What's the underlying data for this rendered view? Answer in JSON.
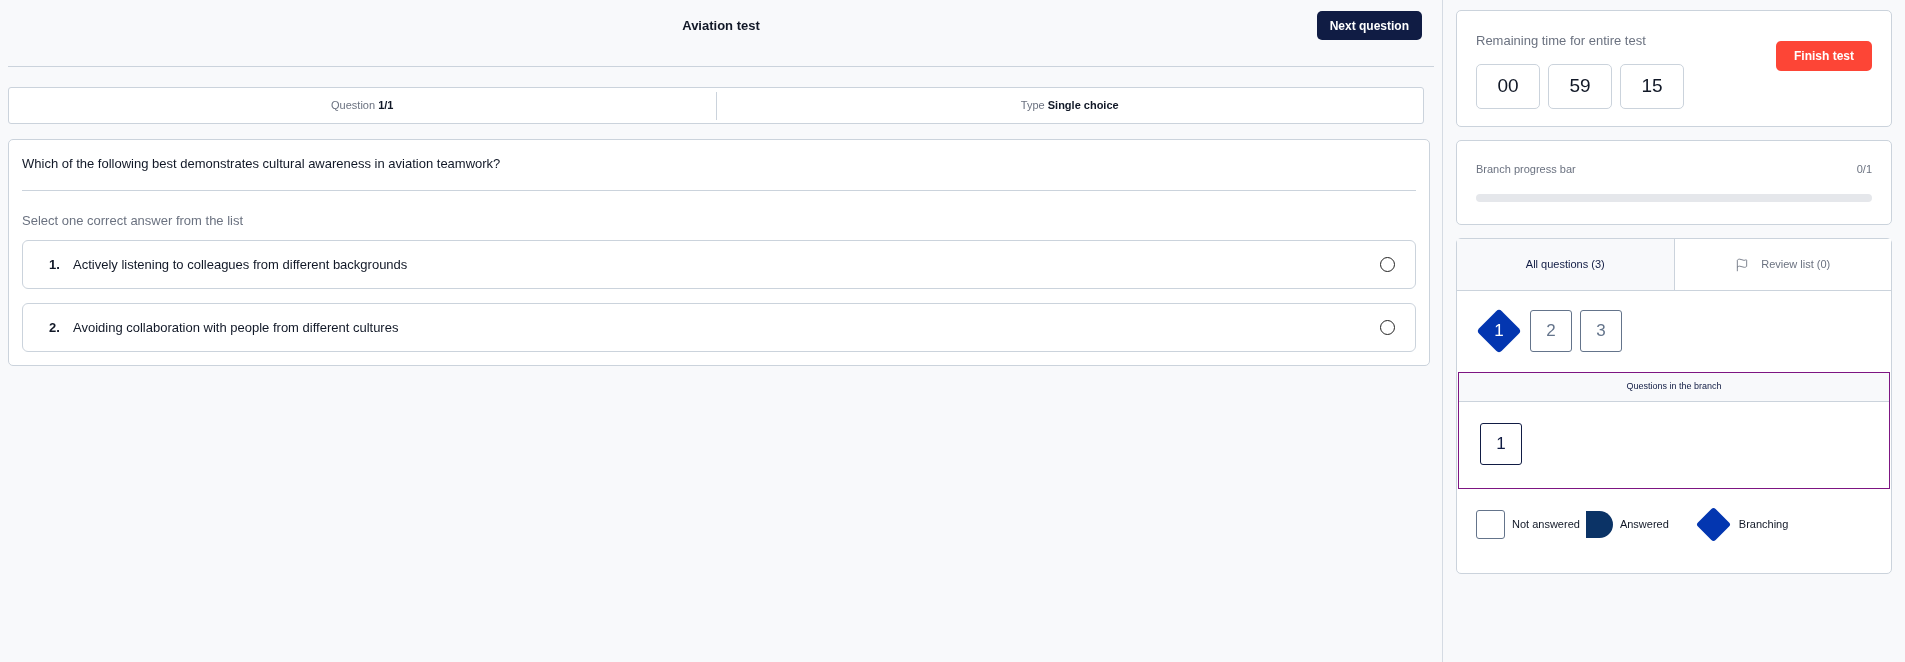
{
  "header": {
    "title": "Aviation test",
    "next_button": "Next question"
  },
  "info_bar": [
    {
      "label": "Question",
      "value": "1/1"
    },
    {
      "label": "Type",
      "value": "Single choice"
    }
  ],
  "question": {
    "text": "Which of the following best demonstrates cultural awareness in aviation teamwork?",
    "instruction": "Select one correct answer from the list",
    "options": [
      {
        "number": "1.",
        "text": "Actively listening to colleagues from different backgrounds",
        "selected": false
      },
      {
        "number": "2.",
        "text": "Avoiding collaboration with people from different cultures",
        "selected": false
      }
    ]
  },
  "timer": {
    "title": "Remaining time for entire test",
    "finish_button": "Finish test",
    "digits": [
      "00",
      "59",
      "15"
    ]
  },
  "progress": {
    "title": "Branch progress bar",
    "count": "0/1",
    "level": 0
  },
  "tabs": [
    {
      "label": "All questions (3)",
      "selected": true,
      "kind": "all"
    },
    {
      "label": "Review list (0)",
      "selected": false,
      "kind": "review"
    }
  ],
  "questions": [
    {
      "label": "1",
      "kind": "branching"
    },
    {
      "label": "2",
      "kind": "not_answered"
    },
    {
      "label": "3",
      "kind": "not_answered"
    }
  ],
  "branch": {
    "title": "Questions in the branch",
    "questions": [
      {
        "label": "1",
        "selected": true
      }
    ]
  },
  "legend": [
    {
      "kind": "not_answered",
      "label": "Not answered"
    },
    {
      "kind": "answered",
      "label": "Answered"
    },
    {
      "kind": "branching",
      "label": "Branching"
    }
  ]
}
